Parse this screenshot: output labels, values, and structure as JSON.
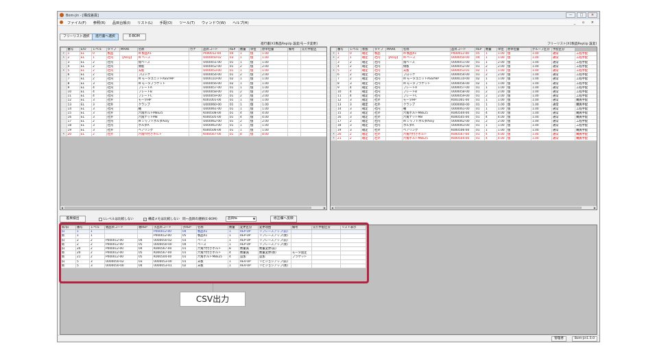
{
  "window": {
    "title": "Bom-jin - [構成差異]",
    "buttons": [
      "—",
      "□",
      "×"
    ],
    "menu": [
      "ファイル(F)",
      "参照(R)",
      "品目台帳(I)",
      "リスト(L)",
      "手配(O)",
      "ツール(T)",
      "ウィンドウ(W)",
      "ヘルプ(H)"
    ],
    "mdi_controls": "_ ▫ ×"
  },
  "toolbar": {
    "freelist": "フリーリスト選択",
    "sourcebook": "進行書へ選択",
    "ebom": "E-BOM"
  },
  "left_caption": "進行書[X1製品RepUp 設変/モータ変更]",
  "right_caption": "フリーリスト[X1製品RepUp 設変]",
  "left_grid": {
    "headers": [
      "",
      "番号",
      "E/O",
      "レベル",
      "タイプ",
      "MARK",
      "名称",
      "カナ",
      "品目コード",
      "REP",
      "数量",
      "単位",
      "原単位量",
      "備考",
      "先行手配区"
    ],
    "rows": [
      {
        "mark": "*",
        "cells": [
          "1",
          "EL",
          "0",
          "製品",
          "",
          "⊟ 製品X1",
          "",
          "P000012-00",
          "04",
          "1",
          "個",
          "1.00",
          "",
          ""
        ],
        "style": "red"
      },
      {
        "mark": "*",
        "cells": [
          "2",
          "EL",
          "1",
          "社内",
          "【Assy】",
          "⊟ ベース",
          "",
          "U000050-02",
          "03",
          "1",
          "個",
          "1.00",
          "",
          ""
        ],
        "style": "red"
      },
      {
        "mark": "",
        "cells": [
          "3",
          "EL",
          "2",
          "社内",
          "",
          "角ベース",
          "",
          "U000051-00",
          "01",
          "1",
          "個",
          "1.00",
          "",
          ""
        ],
        "style": ""
      },
      {
        "mark": "",
        "cells": [
          "4",
          "EL",
          "2",
          "社内",
          "",
          "側板",
          "",
          "U000052-00",
          "01",
          "2",
          "個",
          "2.00",
          "",
          ""
        ],
        "style": ""
      },
      {
        "mark": "*",
        "cells": [
          "5",
          "EL",
          "2",
          "社内",
          "",
          "天板",
          "",
          "U000053-00",
          "01",
          "1",
          "個",
          "1.00",
          "",
          ""
        ],
        "style": "red"
      },
      {
        "mark": "",
        "cells": [
          "6",
          "EL",
          "2",
          "社内",
          "",
          "ブロック",
          "",
          "U000054-00",
          "01",
          "2",
          "個",
          "2.00",
          "",
          ""
        ],
        "style": ""
      },
      {
        "mark": "",
        "cells": [
          "7",
          "EL",
          "2",
          "社内",
          "",
          "⊟ モータユニットASSYHP",
          "",
          "U000110-00",
          "02",
          "1",
          "個",
          "1.00",
          "",
          ""
        ],
        "style": ""
      },
      {
        "mark": "",
        "cells": [
          "8",
          "EL",
          "3",
          "社内",
          "",
          "⊟ モータブラケット",
          "",
          "U000056-00",
          "02",
          "1",
          "個",
          "1.00",
          "",
          ""
        ],
        "style": ""
      },
      {
        "mark": "",
        "cells": [
          "9",
          "EL",
          "4",
          "社内",
          "",
          "プレートA",
          "",
          "U000057-00",
          "01",
          "1",
          "個",
          "1.00",
          "",
          ""
        ],
        "style": ""
      },
      {
        "mark": "",
        "cells": [
          "10",
          "EL",
          "4",
          "社内",
          "",
          "プレートB",
          "",
          "U000058-00",
          "01",
          "2",
          "個",
          "2.00",
          "",
          ""
        ],
        "style": ""
      },
      {
        "mark": "",
        "cells": [
          "11",
          "EL",
          "4",
          "社内",
          "",
          "プレートC",
          "",
          "U000059-00",
          "01",
          "2",
          "個",
          "2.00",
          "",
          ""
        ],
        "style": ""
      },
      {
        "mark": "",
        "cells": [
          "12",
          "EL",
          "3",
          "社外",
          "",
          "モータHP",
          "",
          "K001001-00",
          "01",
          "1",
          "個",
          "1.00",
          "",
          ""
        ],
        "style": ""
      },
      {
        "mark": "",
        "cells": [
          "13",
          "EL",
          "3",
          "社外",
          "",
          "クランプ",
          "",
          "U000060-00",
          "01",
          "1",
          "個",
          "1.00",
          "",
          ""
        ],
        "style": ""
      },
      {
        "mark": "",
        "cells": [
          "14",
          "EL",
          "3",
          "社内",
          "",
          "軸",
          "",
          "U000061-00",
          "01",
          "1",
          "個",
          "1.00",
          "",
          ""
        ],
        "style": ""
      },
      {
        "mark": "",
        "cells": [
          "15",
          "EL",
          "3",
          "社外",
          "",
          "六角ボルトM8x25",
          "",
          "K000508-00",
          "01",
          "4",
          "個",
          "4.00",
          "",
          ""
        ],
        "style": ""
      },
      {
        "mark": "",
        "cells": [
          "16",
          "EL",
          "3",
          "社外",
          "",
          "六角ナットM8",
          "",
          "K000505-00",
          "01",
          "4",
          "個",
          "4.00",
          "",
          ""
        ],
        "style": ""
      },
      {
        "mark": "",
        "cells": [
          "17",
          "EL",
          "2",
          "社内",
          "",
          "⊟ シャフトホルダAssy",
          "",
          "U000062-00",
          "01",
          "2",
          "個",
          "2.00",
          "",
          ""
        ],
        "style": ""
      },
      {
        "mark": "",
        "cells": [
          "18",
          "EL",
          "3",
          "社内",
          "",
          "ホルダA",
          "",
          "U000063-00",
          "01",
          "1",
          "個",
          "1.00",
          "",
          ""
        ],
        "style": ""
      },
      {
        "mark": "",
        "cells": [
          "19",
          "EL",
          "3",
          "社外",
          "",
          "ベアリング",
          "",
          "K000506-00",
          "01",
          "1",
          "個",
          "1.00",
          "",
          ""
        ],
        "style": ""
      },
      {
        "mark": "*",
        "cells": [
          "20",
          "EL",
          "2",
          "社外",
          "",
          "六角穴付きボルト",
          "",
          "K000567-00",
          "01",
          "8",
          "個",
          "8.00",
          "",
          ""
        ],
        "style": "red"
      }
    ]
  },
  "right_grid": {
    "headers": [
      "",
      "番号",
      "レベル",
      "状態",
      "タイプ",
      "MARK",
      "名称",
      "品目コード",
      "REP",
      "数量",
      "単位",
      "原単位量",
      "グループ区分",
      "手配区分"
    ],
    "rows": [
      {
        "mark": "*",
        "cells": [
          "1",
          "0",
          "確定",
          "製品",
          "",
          "⊟ 製品X1",
          "P000012-00",
          "05",
          "1",
          "1.00",
          "個",
          "1.00",
          "通常",
          "工程手配"
        ],
        "style": "red"
      },
      {
        "mark": "*",
        "cells": [
          "2",
          "1",
          "確定",
          "社内",
          "【Assy】",
          "⊟ ベース",
          "U000050-00",
          "04",
          "1",
          "1.00",
          "個",
          "1.00",
          "通常",
          "工程手配"
        ],
        "style": "red"
      },
      {
        "mark": "",
        "cells": [
          "3",
          "2",
          "確定",
          "社内",
          "",
          "角ベース",
          "U000051-00",
          "01",
          "1",
          "2.00",
          "個",
          "1.00",
          "通常",
          "工程手配"
        ],
        "style": ""
      },
      {
        "mark": "",
        "cells": [
          "4",
          "2",
          "確定",
          "社内",
          "",
          "側板",
          "U000052-00",
          "01",
          "2",
          "2.00",
          "個",
          "1.00",
          "通常",
          "工程手配"
        ],
        "style": ""
      },
      {
        "mark": "*",
        "cells": [
          "5",
          "2",
          "確定",
          "社内",
          "",
          "天板",
          "U000053-01",
          "02",
          "1",
          "1.00",
          "個",
          "1.00",
          "通常",
          "工程手配"
        ],
        "style": "red"
      },
      {
        "mark": "",
        "cells": [
          "6",
          "2",
          "確定",
          "社内",
          "",
          "ブロック",
          "U000054-00",
          "01",
          "2",
          "2.00",
          "個",
          "1.00",
          "通常",
          "工程手配"
        ],
        "style": ""
      },
      {
        "mark": "",
        "cells": [
          "7",
          "2",
          "確定",
          "社内",
          "",
          "⊟ モータユニットASSYHP",
          "U000110-00",
          "02",
          "1",
          "1.00",
          "個",
          "1.00",
          "通常",
          "工程手配"
        ],
        "style": ""
      },
      {
        "mark": "",
        "cells": [
          "8",
          "3",
          "確定",
          "社内",
          "",
          "⊟ モータブラケット",
          "U000056-00",
          "02",
          "1",
          "1.00",
          "個",
          "1.00",
          "通常",
          "工程手配"
        ],
        "style": ""
      },
      {
        "mark": "",
        "cells": [
          "9",
          "4",
          "確定",
          "社内",
          "",
          "プレートA",
          "U000057-00",
          "01",
          "1",
          "1.00",
          "個",
          "1.00",
          "通常",
          "工程手配"
        ],
        "style": ""
      },
      {
        "mark": "",
        "cells": [
          "10",
          "4",
          "確定",
          "社内",
          "",
          "プレートB",
          "U000058-00",
          "01",
          "2",
          "2.00",
          "個",
          "1.00",
          "通常",
          "工程手配"
        ],
        "style": ""
      },
      {
        "mark": "",
        "cells": [
          "11",
          "4",
          "確定",
          "社内",
          "",
          "プレートC",
          "U000059-00",
          "01",
          "2",
          "2.00",
          "個",
          "1.00",
          "通常",
          "工程手配"
        ],
        "style": ""
      },
      {
        "mark": "",
        "cells": [
          "12",
          "3",
          "確定",
          "社外",
          "",
          "モータHP",
          "K001001-00",
          "01",
          "1",
          "1.00",
          "個",
          "1.00",
          "通常",
          "購買手配"
        ],
        "style": ""
      },
      {
        "mark": "",
        "cells": [
          "13",
          "3",
          "確定",
          "社外",
          "",
          "クランプ",
          "U000060-00",
          "01",
          "1",
          "1.00",
          "個",
          "1.00",
          "通常",
          "購買手配"
        ],
        "style": ""
      },
      {
        "mark": "",
        "cells": [
          "14",
          "3",
          "確定",
          "社内",
          "",
          "軸",
          "U000061-00",
          "01",
          "1",
          "1.00",
          "個",
          "1.00",
          "通常",
          "工程手配"
        ],
        "style": ""
      },
      {
        "mark": "",
        "cells": [
          "15",
          "3",
          "確定",
          "社外",
          "",
          "六角ボルトM8x25",
          "K000504-00",
          "01",
          "4",
          "4.00",
          "個",
          "1.00",
          "通常",
          "購買手配"
        ],
        "style": ""
      },
      {
        "mark": "",
        "cells": [
          "16",
          "3",
          "確定",
          "社外",
          "",
          "六角ナットM8",
          "K000505-00",
          "01",
          "4",
          "4.00",
          "個",
          "1.00",
          "通常",
          "購買手配"
        ],
        "style": ""
      },
      {
        "mark": "",
        "cells": [
          "17",
          "2",
          "確定",
          "社内",
          "",
          "⊟ シャフトホルダAssy",
          "U000062-00",
          "01",
          "2",
          "2.00",
          "個",
          "1.00",
          "通常",
          "工程手配"
        ],
        "style": ""
      },
      {
        "mark": "",
        "cells": [
          "18",
          "3",
          "確定",
          "社内",
          "",
          "ホルダA",
          "U000063-00",
          "01",
          "1",
          "1.00",
          "個",
          "1.00",
          "通常",
          "工程手配"
        ],
        "style": ""
      },
      {
        "mark": "",
        "cells": [
          "19",
          "3",
          "確定",
          "社外",
          "",
          "ベアリング",
          "K000506-00",
          "01",
          "1",
          "1.00",
          "個",
          "1.00",
          "通常",
          "購買手配"
        ],
        "style": ""
      },
      {
        "mark": "*",
        "cells": [
          "20",
          "2",
          "確定",
          "社外",
          "",
          "六角穴付きボルト",
          "K000567-00",
          "01",
          "4",
          "4.00",
          "個",
          "1.00",
          "通常",
          "購買手配"
        ],
        "style": "red"
      },
      {
        "mark": "*",
        "cells": [
          "21",
          "2",
          "確定",
          "社外",
          "",
          "六角ボルトM8x25",
          "K000504-00",
          "01",
          "4",
          "4.00",
          "個",
          "1.00",
          "通常",
          "購買手配"
        ],
        "style": "red"
      }
    ]
  },
  "controls": {
    "detect_button": "差異検出",
    "chk_level": "Lレベルは比較しない",
    "chk_struct_memo": "構成メモは比較しない",
    "same_item_label": "同一品目の選択(E-BOM)",
    "select_value": "品目№",
    "apply_button": "修正欄へ反映"
  },
  "diff_grid": {
    "headers": [
      "新/旧",
      "番号",
      "レベル",
      "親品目コード",
      "親REP",
      "子品目コード",
      "子REP",
      "名称",
      "数量",
      "変更区分",
      "変更理由",
      "備考",
      "先行手配区分",
      "リスト表示"
    ],
    "rows": [
      {
        "cells": [
          "旧",
          "1",
          "1",
          "",
          "",
          "P000012-00",
          "04",
          "製品X1",
          "1",
          "REP-UP",
          "リプレースアップ(前)",
          "",
          "",
          ""
        ],
        "style": "blue sel"
      },
      {
        "cells": [
          "新",
          "1",
          "1",
          "",
          "",
          "P000012-00",
          "05",
          "製品X1",
          "1",
          "REP-UP",
          "リプレースアップ(後)",
          "",
          "",
          ""
        ],
        "style": ""
      },
      {
        "cells": [
          "旧",
          "2",
          "2",
          "P000012-00",
          "04",
          "U000050-02",
          "03",
          "ベース",
          "1",
          "REP-UP",
          "リプレースアップ(前)",
          "",
          "",
          ""
        ],
        "style": ""
      },
      {
        "cells": [
          "新",
          "2",
          "2",
          "P000012-00",
          "05",
          "U000050-00",
          "04",
          "ベース",
          "1",
          "REP-UP",
          "リプレースアップ(後)",
          "",
          "",
          ""
        ],
        "style": ""
      },
      {
        "cells": [
          "旧",
          "20",
          "2",
          "P000012-00",
          "04",
          "K000567-00",
          "01",
          "六角穴付きボルト",
          "8",
          "数量減",
          "数量変更(前)",
          "",
          "",
          ""
        ],
        "style": ""
      },
      {
        "cells": [
          "新",
          "20",
          "2",
          "P000012-00",
          "05",
          "K000567-00",
          "01",
          "六角穴付きボルト",
          "4",
          "数量減",
          "数量変更(後)",
          "モータ固定",
          "",
          ""
        ],
        "style": ""
      },
      {
        "cells": [
          "新",
          "21",
          "2",
          "P000012-00",
          "05",
          "K000504-00",
          "01",
          "六角ボルトM8x25",
          "4",
          "追加",
          "追加",
          "ブラケット",
          "",
          ""
        ],
        "style": ""
      },
      {
        "cells": [
          "旧",
          "5",
          "3",
          "U000050-02",
          "03",
          "U000053-00",
          "01",
          "天板",
          "1",
          "REV-UP",
          "リビジョンアップ(前)",
          "",
          "",
          ""
        ],
        "style": ""
      },
      {
        "cells": [
          "新",
          "5",
          "3",
          "U000050-00",
          "04",
          "U000053-01",
          "02",
          "天板",
          "1",
          "REV-UP",
          "リビジョンアップ(後)",
          "",
          "",
          ""
        ],
        "style": ""
      }
    ]
  },
  "status": {
    "user": "管理者",
    "version": "Bom-jin1.5.0"
  },
  "callout": {
    "label": "CSV出力",
    "color": "#b3223f"
  }
}
